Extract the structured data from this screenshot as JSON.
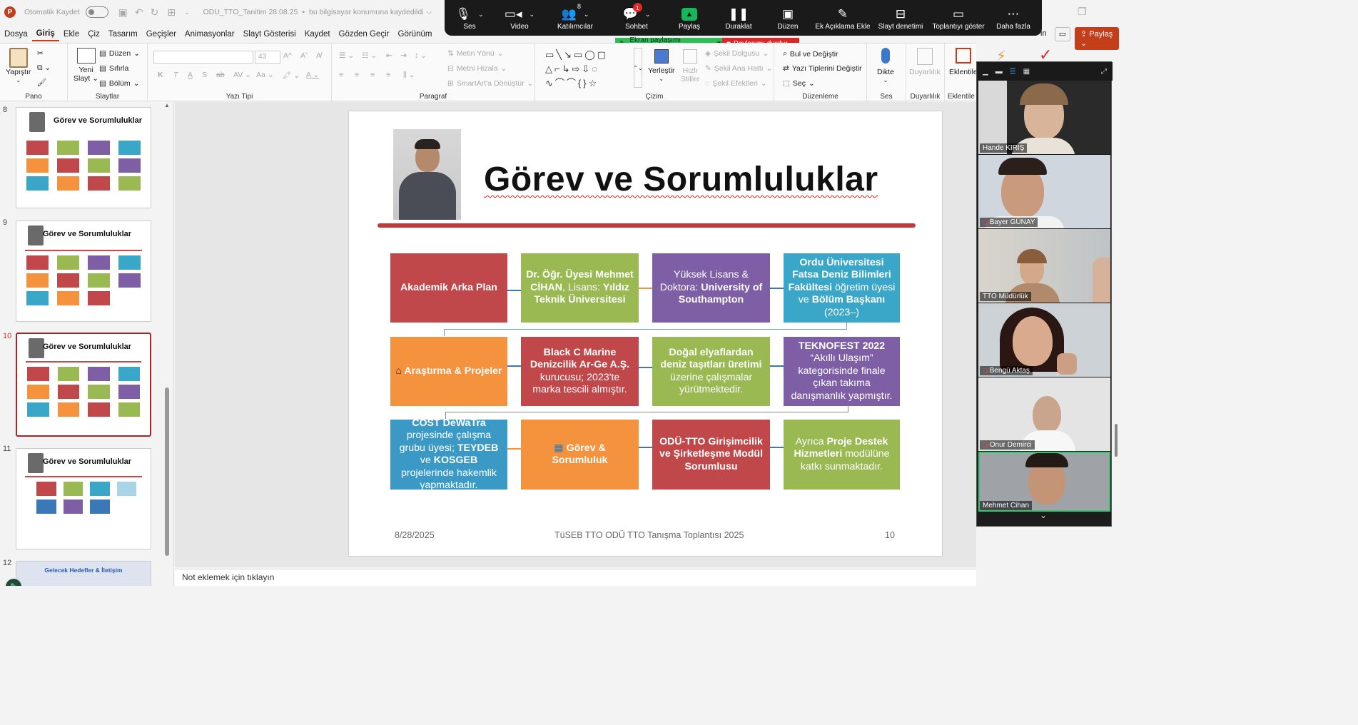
{
  "window": {
    "autosave_label": "Otomatik Kaydet",
    "file_name": "ODU_TTO_Tanitim 28.08.25",
    "save_status": "bu bilgisayar konumuna kaydedildi"
  },
  "zoom_toolbar": {
    "items": [
      {
        "label": "Ses",
        "icon": "microphone-icon"
      },
      {
        "label": "Video",
        "icon": "video-camera-icon"
      },
      {
        "label": "Katılımcılar",
        "icon": "participants-icon",
        "count": "8"
      },
      {
        "label": "Sohbet",
        "icon": "chat-icon",
        "badge": "1"
      },
      {
        "label": "Paylaş",
        "icon": "share-screen-icon"
      },
      {
        "label": "Duraklat",
        "icon": "pause-icon"
      },
      {
        "label": "Düzen",
        "icon": "layout-icon"
      },
      {
        "label": "Ek Açıklama Ekle",
        "icon": "annotate-icon"
      },
      {
        "label": "Slayt denetimi",
        "icon": "slide-control-icon"
      },
      {
        "label": "Toplantıyı göster",
        "icon": "show-meeting-icon"
      },
      {
        "label": "Daha fazla",
        "icon": "more-icon"
      }
    ],
    "share_banner": "Ekran paylaşımı yapıyorsunuz",
    "stop_share": "Paylaşımı durdur"
  },
  "menu": {
    "items": [
      "Dosya",
      "Giriş",
      "Ekle",
      "Çiz",
      "Tasarım",
      "Geçişler",
      "Animasyonlar",
      "Slayt Gösterisi",
      "Kaydet",
      "Gözden Geçir",
      "Görünüm"
    ],
    "active": "Giriş",
    "share_button": "Paylaş",
    "partial_right": "in"
  },
  "ribbon": {
    "groups": {
      "pano": "Pano",
      "slaytlar": "Slaytlar",
      "yazi_tipi": "Yazı Tipi",
      "paragraf": "Paragraf",
      "cizim": "Çizim",
      "duzenleme": "Düzenleme",
      "ses": "Ses",
      "duyarlilik": "Duyarlılık",
      "eklentiler": "Eklentile"
    },
    "yapistir": "Yapıştır",
    "yeni_slayt_1": "Yeni",
    "yeni_slayt_2": "Slayt",
    "duzen": "Düzen",
    "sifirla": "Sıfırla",
    "bolum": "Bölüm",
    "font_size": "43",
    "metin_yonu": "Metin Yönü",
    "metni_hizala": "Metni Hizala",
    "smartart": "SmartArt'a Dönüştür",
    "yerlestir": "Yerleştir",
    "hizli_stiller_1": "Hızlı",
    "hizli_stiller_2": "Stiller",
    "sekil_dolgusu": "Şekil Dolgusu",
    "sekil_ana_hatti": "Şekil Ana Hattı",
    "sekil_efektleri": "Şekil Efektleri",
    "bul_degistir": "Bul ve Değiştir",
    "yazi_tipleri_degistir": "Yazı Tiplerini Değiştir",
    "sec": "Seç",
    "dikte": "Dikte",
    "duyarlilik": "Duyarlılık",
    "eklentiler": "Eklentile"
  },
  "thumbnails": [
    {
      "num": "8",
      "title": "Görev ve Sorumluluklar"
    },
    {
      "num": "9",
      "title": "Görev ve Sorumluluklar"
    },
    {
      "num": "10",
      "title": "Görev ve Sorumluluklar"
    },
    {
      "num": "11",
      "title": "Görev ve Sorumluluklar"
    },
    {
      "num": "12",
      "title": "Gelecek Hedefler & İletişim"
    }
  ],
  "slide": {
    "title": "Görev ve Sorumluluklar",
    "footer_date": "8/28/2025",
    "footer_center": "TüSEB TTO ODÜ TTO Tanışma Toplantısı 2025",
    "footer_page": "10",
    "boxes": {
      "b1": "Akademik Arka Plan",
      "b2_a": "Dr. Öğr. Üyesi Mehmet CİHAN",
      "b2_b": ", Lisans: ",
      "b2_c": "Yıldız Teknik Üniversitesi",
      "b3_a": "Yüksek Lisans & Doktora: ",
      "b3_b": "University of Southampton",
      "b4_a": "Ordu Üniversitesi Fatsa Deniz Bilimleri Fakültesi",
      "b4_b": " öğretim üyesi ve ",
      "b4_c": "Bölüm Başkanı",
      "b4_d": " (2023–)",
      "b5": "Araştırma & Projeler",
      "b6_a": "Black C Marine Denizcilik Ar-Ge A.Ş.",
      "b6_b": " kurucusu; 2023'te marka tescili almıştır.",
      "b7_a": "Doğal elyaflardan deniz taşıtları üretimi",
      "b7_b": " üzerine çalışmalar yürütmektedir.",
      "b8_a": "TEKNOFEST 2022",
      "b8_b": " “Akıllı Ulaşım” kategorisinde finale çıkan takıma danışmanlık yapmıştır.",
      "b9_a": "COST DeWaTra",
      "b9_b": " projesinde çalışma grubu üyesi; ",
      "b9_c": "TEYDEB",
      "b9_d": " ve ",
      "b9_e": "KOSGEB",
      "b9_f": " projelerinde hakemlik yapmaktadır.",
      "b10": "Görev & Sorumluluk",
      "b11": "ODÜ-TTO Girişimcilik ve Şirketleşme Modül Sorumlusu",
      "b12_a": "Ayrıca ",
      "b12_b": "Proje Destek Hizmetleri",
      "b12_c": " modülüne katkı sunmaktadır."
    }
  },
  "notes_placeholder": "Not eklemek için tıklayın",
  "participants": [
    {
      "name": "Hande KIRIŞ",
      "muted": false
    },
    {
      "name": "Bayer GÜNAY",
      "muted": true
    },
    {
      "name": "TTO Müdürlük",
      "muted": false
    },
    {
      "name": "Bengü Aktaş",
      "muted": true
    },
    {
      "name": "Onur Demirci",
      "muted": true
    },
    {
      "name": "Mehmet Cihan",
      "muted": false
    }
  ],
  "colors": {
    "accent": "#c43e1c",
    "red": "#c0474a",
    "green": "#9ab952",
    "purple": "#7e5fa5",
    "blue": "#3ba7c8",
    "orange": "#f4923e",
    "zoom_green": "#12b85a"
  }
}
